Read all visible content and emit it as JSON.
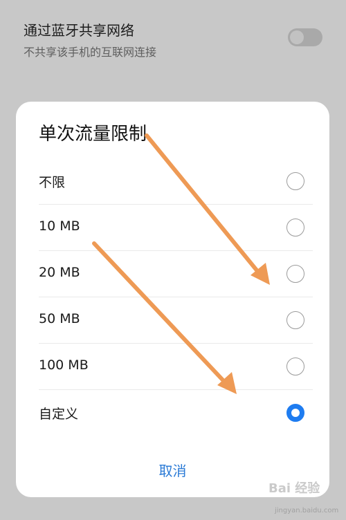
{
  "background_setting": {
    "title": "通过蓝牙共享网络",
    "subtitle": "不共享该手机的互联网连接",
    "toggle_on": false
  },
  "dialog": {
    "title": "单次流量限制",
    "options": [
      {
        "label": "不限",
        "selected": false
      },
      {
        "label": "10 MB",
        "selected": false
      },
      {
        "label": "20 MB",
        "selected": false
      },
      {
        "label": "50 MB",
        "selected": false
      },
      {
        "label": "100 MB",
        "selected": false
      },
      {
        "label": "自定义",
        "selected": true
      }
    ],
    "cancel_label": "取消"
  },
  "colors": {
    "accent": "#1e7cf0",
    "cancel_text": "#2a7ad6",
    "annotation_arrow": "#ee9a55"
  },
  "watermark": {
    "text": "Bai 经验",
    "sub": "jingyan.baidu.com"
  }
}
